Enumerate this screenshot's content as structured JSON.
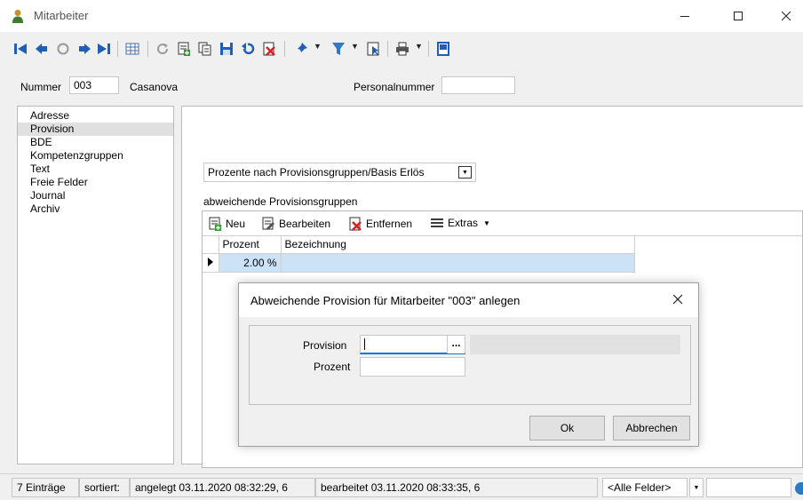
{
  "window": {
    "title": "Mitarbeiter"
  },
  "header": {
    "nummer_label": "Nummer",
    "nummer_value": "003",
    "name": "Casanova",
    "personalnummer_label": "Personalnummer",
    "personalnummer_value": ""
  },
  "nav": {
    "items": [
      {
        "label": "Adresse"
      },
      {
        "label": "Provision",
        "selected": true
      },
      {
        "label": "BDE"
      },
      {
        "label": "Kompetenzgruppen"
      },
      {
        "label": "Text"
      },
      {
        "label": "Freie Felder"
      },
      {
        "label": "Journal"
      },
      {
        "label": "Archiv"
      }
    ]
  },
  "main": {
    "mode_combo": "Prozente nach Provisionsgruppen/Basis Erlös",
    "section_label": "abweichende Provisionsgruppen",
    "grid_tools": {
      "new": "Neu",
      "edit": "Bearbeiten",
      "remove": "Entfernen",
      "extras": "Extras"
    },
    "columns": [
      "Prozent",
      "Bezeichnung"
    ],
    "rows": [
      {
        "prozent": "2.00 %",
        "bezeichnung": ""
      }
    ]
  },
  "dialog": {
    "title": "Abweichende Provision für Mitarbeiter \"003\" anlegen",
    "provision_label": "Provision",
    "provision_value": "",
    "browse_label": "...",
    "prozent_label": "Prozent",
    "prozent_value": "",
    "ok": "Ok",
    "cancel": "Abbrechen"
  },
  "status": {
    "count": "7 Einträge",
    "sorted": "sortiert:",
    "created": "angelegt 03.11.2020 08:32:29, 6",
    "edited": "bearbeitet 03.11.2020 08:33:35, 6",
    "field_filter": "<Alle Felder>"
  },
  "colors": {
    "selection": "#cce3f7",
    "nav_selection": "#e0e0e0",
    "accent": "#0078d7"
  }
}
